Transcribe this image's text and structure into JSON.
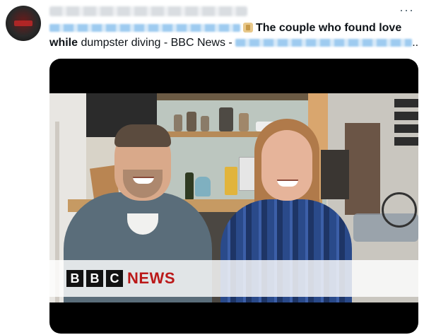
{
  "post": {
    "headline_bold_1": "The couple who found love",
    "headline_bold_2": "while",
    "headline_rest": " dumpster diving - BBC News -",
    "trailing_ellipsis": ".."
  },
  "overflow_menu": {
    "label": "···"
  },
  "media": {
    "broadcaster_blocks": [
      "B",
      "B",
      "C"
    ],
    "broadcaster_label": "NEWS"
  },
  "colors": {
    "bbc_red": "#bb1919",
    "link_blue": "#1d9bf0",
    "text": "#0f1419"
  }
}
